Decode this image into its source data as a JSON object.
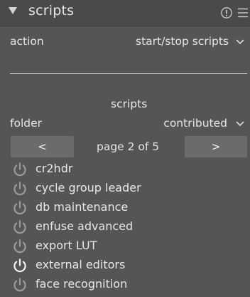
{
  "module": {
    "title": "scripts"
  },
  "action": {
    "label": "action",
    "value": "start/stop scripts"
  },
  "section": {
    "title": "scripts"
  },
  "folder": {
    "label": "folder",
    "value": "contributed"
  },
  "pagination": {
    "prev_label": "<",
    "page_text": "page 2 of 5",
    "next_label": ">"
  },
  "scripts": [
    {
      "name": "cr2hdr",
      "active": false
    },
    {
      "name": "cycle group leader",
      "active": false
    },
    {
      "name": "db maintenance",
      "active": false
    },
    {
      "name": "enfuse advanced",
      "active": false
    },
    {
      "name": "export LUT",
      "active": false
    },
    {
      "name": "external editors",
      "active": true
    },
    {
      "name": "face recognition",
      "active": false
    }
  ],
  "colors": {
    "icon_inactive": "#9a9a9a",
    "icon_active": "#f0f0f0"
  }
}
